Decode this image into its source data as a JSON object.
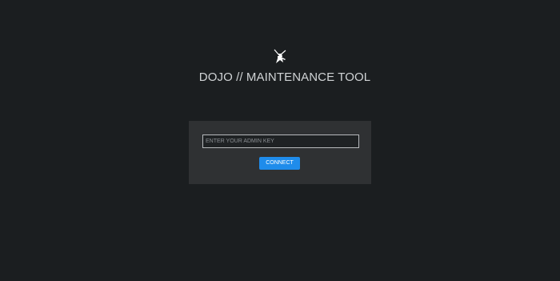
{
  "app": {
    "logo_icon": "ninja-sword-icon",
    "title": "DOJO // MAINTENANCE TOOL"
  },
  "login": {
    "key_placeholder": "ENTER YOUR ADMIN KEY",
    "key_value": "",
    "connect_label": "CONNECT"
  },
  "colors": {
    "background": "#1b1e20",
    "panel": "#2f3133",
    "accent": "#1f8ceb"
  }
}
